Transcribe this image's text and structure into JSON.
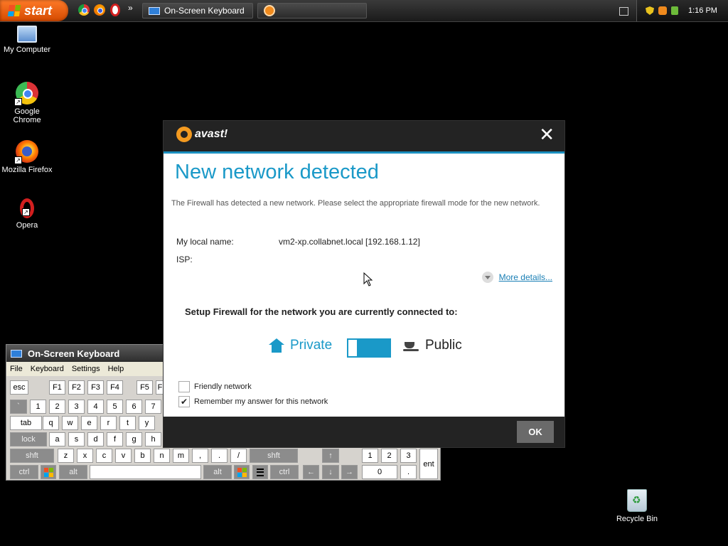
{
  "taskbar": {
    "start_label": "start",
    "more_label": "»",
    "tasks": [
      {
        "label": "On-Screen Keyboard"
      },
      {
        "label": ""
      }
    ],
    "clock": "1:16 PM"
  },
  "desktop": {
    "icons": [
      {
        "label": "My Computer"
      },
      {
        "label": "Google Chrome"
      },
      {
        "label": "Mozilla Firefox"
      },
      {
        "label": "Opera"
      },
      {
        "label": "Recycle Bin"
      }
    ]
  },
  "osk": {
    "title": "On-Screen Keyboard",
    "menu": [
      "File",
      "Keyboard",
      "Settings",
      "Help"
    ],
    "keys": {
      "esc": "esc",
      "f1": "F1",
      "f2": "F2",
      "f3": "F3",
      "f4": "F4",
      "f5": "F5",
      "f6": "F",
      "grave": "`",
      "n1": "1",
      "n2": "2",
      "n3": "3",
      "n4": "4",
      "n5": "5",
      "n6": "6",
      "n7": "7",
      "tab": "tab",
      "q": "q",
      "w": "w",
      "e": "e",
      "r": "r",
      "t": "t",
      "y": "y",
      "lock": "lock",
      "a": "a",
      "s": "s",
      "d": "d",
      "f": "f",
      "g": "g",
      "h": "h",
      "lshft": "shft",
      "z": "z",
      "x": "x",
      "c": "c",
      "v": "v",
      "b": "b",
      "n": "n",
      "m": "m",
      "comma": ",",
      "period": ".",
      "slash": "/",
      "rshft": "shft",
      "lctrl": "ctrl",
      "lalt": "alt",
      "ralt": "alt",
      "rctrl": "ctrl",
      "up": "↑",
      "left": "←",
      "down": "↓",
      "right": "→",
      "np1": "1",
      "np2": "2",
      "np3": "3",
      "np0": "0",
      "npdot": ".",
      "ent": "ent"
    }
  },
  "dialog": {
    "logo": "avast!",
    "close": "✕",
    "title": "New network detected",
    "description": "The Firewall has detected a new network. Please select the appropriate firewall mode for the new network.",
    "local_name_label": "My local name:",
    "local_name_value": "vm2-xp.collabnet.local [192.168.1.12]",
    "isp_label": "ISP:",
    "more_details": "More details...",
    "setup_text": "Setup Firewall for the network you are currently connected to:",
    "private_label": "Private",
    "public_label": "Public",
    "selected_mode": "Private",
    "friendly_label": "Friendly network",
    "friendly_checked": false,
    "remember_label": "Remember my answer for this network",
    "remember_checked": true,
    "ok_label": "OK"
  },
  "colors": {
    "accent": "#1a99c8",
    "dialog_header": "#232323",
    "start_button": "#e8600f"
  }
}
